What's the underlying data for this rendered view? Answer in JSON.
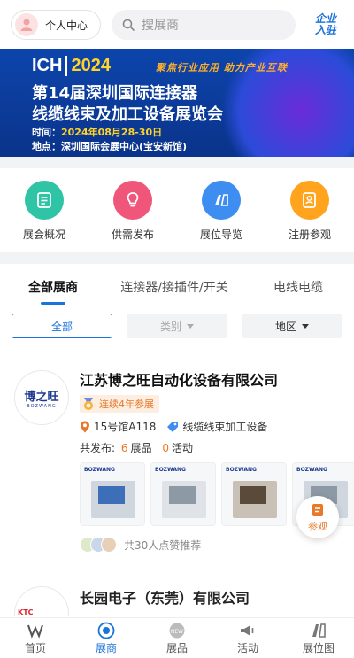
{
  "header": {
    "user_center": "个人中心",
    "search_placeholder": "搜展商",
    "join_line1": "企业",
    "join_line2": "入驻"
  },
  "banner": {
    "brand": "ICH",
    "year": "2024",
    "slogan": "聚焦行业应用  助力产业互联",
    "title_line1": "第14届深圳国际连接器",
    "title_line2": "线缆线束及加工设备展览会",
    "time_label": "时间：",
    "time_value": "2024年08月28-30日",
    "place_label": "地点：",
    "place_value": "深圳国际会展中心(宝安新馆)"
  },
  "quick_menu": [
    {
      "label": "展会概况",
      "icon": "document-icon",
      "color": "#2ec4a5"
    },
    {
      "label": "供需发布",
      "icon": "lightbulb-icon",
      "color": "#f0557a"
    },
    {
      "label": "展位导览",
      "icon": "map-icon",
      "color": "#3d8ef0"
    },
    {
      "label": "注册参观",
      "icon": "register-icon",
      "color": "#ffa41c"
    }
  ],
  "tabs": [
    "全部展商",
    "连接器/接插件/开关",
    "电线电缆"
  ],
  "filters": {
    "all": "全部",
    "category": "类别",
    "region": "地区"
  },
  "exhibitor": {
    "logo_text": "博之旺",
    "logo_sub": "BOZWANG",
    "name": "江苏博之旺自动化设备有限公司",
    "badge": "连续4年参展",
    "hall": "15号馆A118",
    "category": "线缆线束加工设备",
    "total_prefix": "共发布:",
    "products_count": "6",
    "products_label": "展品",
    "activities_count": "0",
    "activities_label": "活动",
    "thumb_brand": "BOZWANG",
    "likes_text": "共30人点赞推荐"
  },
  "fab_label": "参观",
  "exhibitor2": {
    "name": "长园电子（东莞）有限公司",
    "logo_text": "KTC"
  },
  "bottom_nav": [
    {
      "label": "首页",
      "icon": "home-icon"
    },
    {
      "label": "展商",
      "icon": "exhibitor-icon"
    },
    {
      "label": "展品",
      "icon": "product-icon"
    },
    {
      "label": "活动",
      "icon": "activity-icon"
    },
    {
      "label": "展位图",
      "icon": "floorplan-icon"
    }
  ],
  "colors": {
    "accent": "#1a73d8",
    "orange": "#e8792a"
  }
}
